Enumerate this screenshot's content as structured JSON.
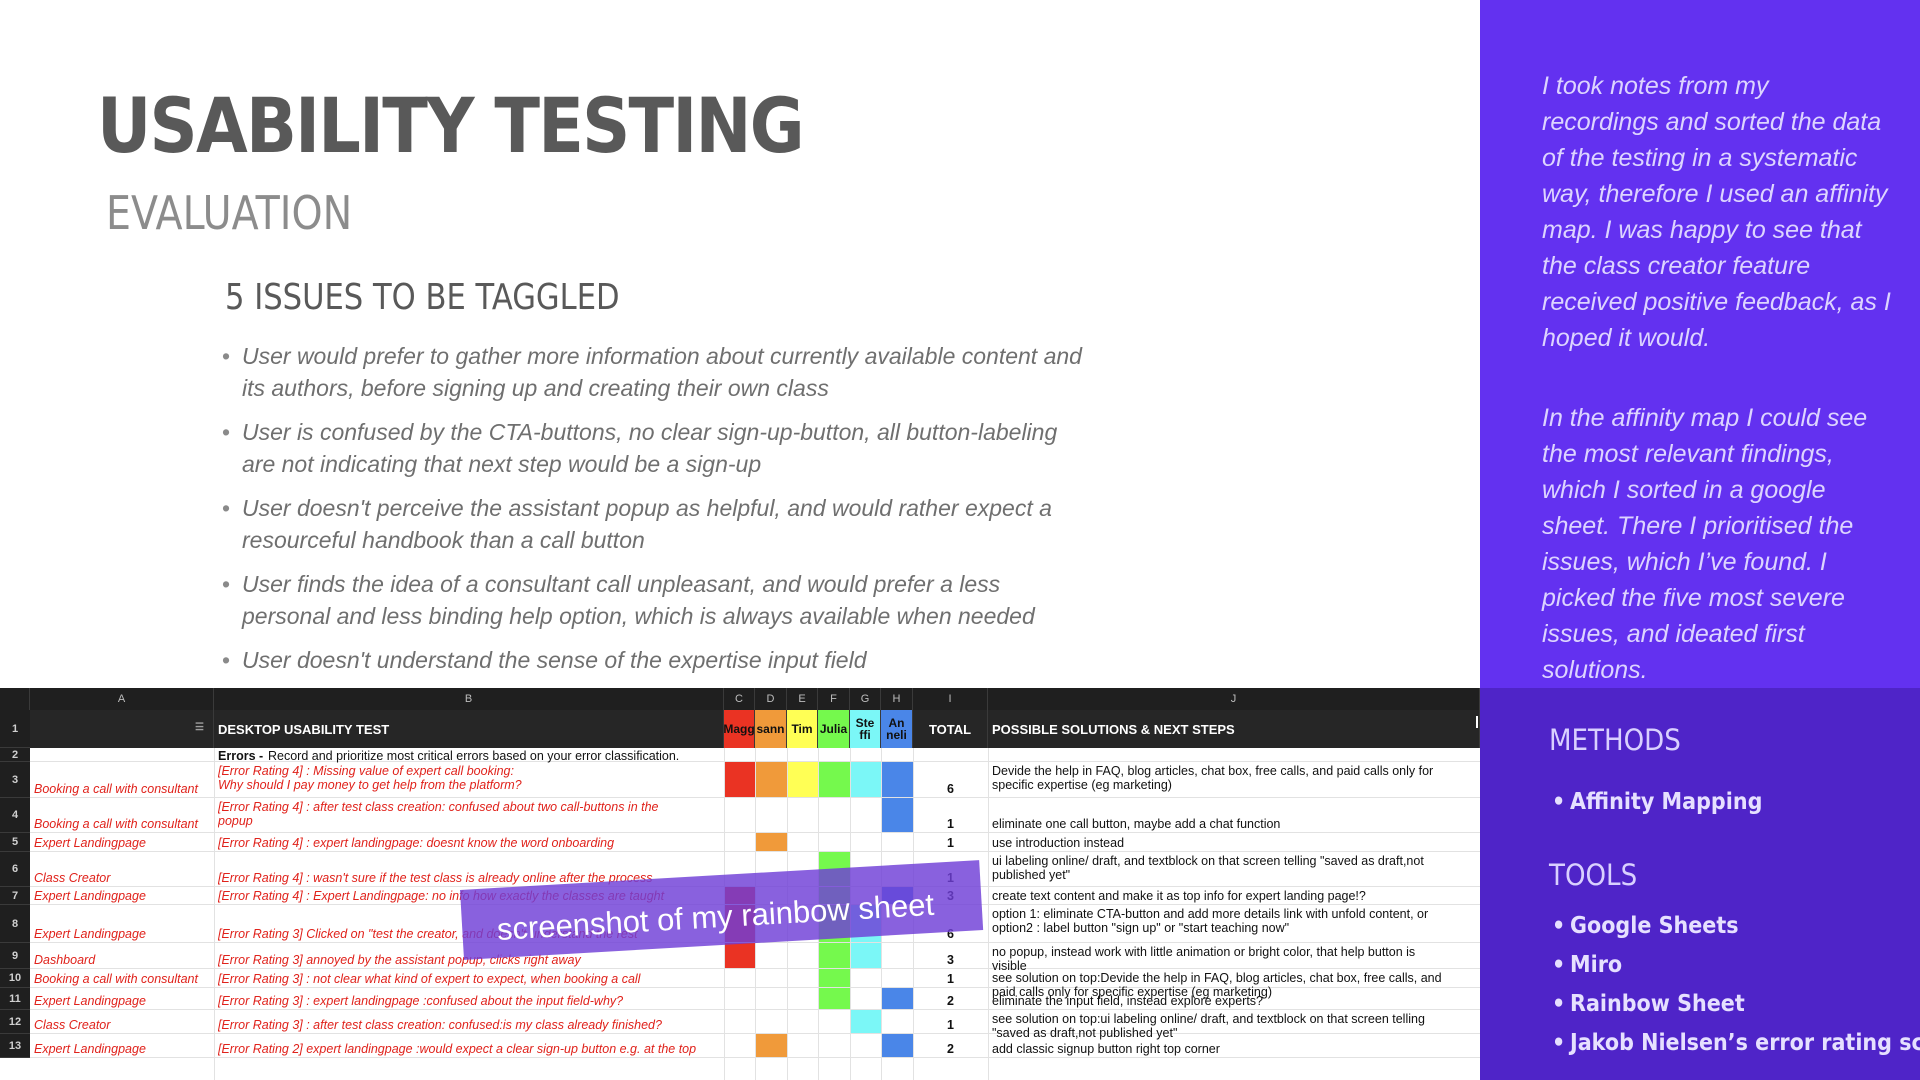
{
  "slide": {
    "title": "USABILITY TESTING",
    "subtitle": "EVALUATION",
    "issues_heading": "5 ISSUES TO BE TAGGLED",
    "issues": [
      "User would prefer to gather more information about currently available content and its authors, before signing up and creating their own class",
      "User is confused by the CTA-buttons, no clear sign-up-button, all button-labeling are not indicating that next step would be a sign-up",
      "User doesn't perceive the assistant popup as helpful, and would rather expect a resourceful handbook than a call button",
      "User finds the idea of a consultant call unpleasant, and would prefer a less personal and less binding help option, which is always available when needed",
      "User doesn't understand the sense of the expertise input field"
    ]
  },
  "panel": {
    "note_1": "I took notes from my recordings and sorted the data of the testing in a systematic way, therefore I used an affinity map. I was happy to see that the class creator feature received positive feedback, as I hoped it would.",
    "note_2": "In the affinity map I could see the most relevant findings, which I sorted in a google sheet. There I prioritised the issues, which I’ve found. I picked the five most severe issues, and ideated first solutions.",
    "methods_heading": "METHODS",
    "methods": [
      "Affinity Mapping"
    ],
    "tools_heading": "TOOLS",
    "tools": [
      "Google Sheets",
      "Miro",
      "Rainbow Sheet",
      "Jakob Nielsen’s error rating scale"
    ]
  },
  "sheet": {
    "column_letters": [
      "A",
      "B",
      "C",
      "D",
      "E",
      "F",
      "G",
      "H",
      "I",
      "J"
    ],
    "header_b": "DESKTOP USABILITY TEST",
    "participants": [
      "Magg",
      "sann",
      "Tim",
      "Julia",
      "Ste ffi",
      "An neli"
    ],
    "participant_colors": [
      "#ea3323",
      "#f09a3a",
      "#ffff55",
      "#75f94d",
      "#7bf7f7",
      "#4a86e8"
    ],
    "header_total": "TOTAL",
    "header_j": "POSSIBLE SOLUTIONS & NEXT STEPS",
    "row_numbers": [
      "1",
      "2",
      "3",
      "4",
      "5",
      "6",
      "7",
      "8",
      "9",
      "10",
      "11",
      "12",
      "13"
    ],
    "errors_label": "Errors -",
    "errors_desc": "Record and prioritize most critical errors based on your error classification.",
    "rows": [
      {
        "a": "Booking a call with consultant",
        "b1": "[Error Rating 4] : Missing value of expert call booking:",
        "b2": "Why should I pay money to get help from the platform?",
        "total": "6",
        "j1": "Devide the help in FAQ, blog articles, chat box, free calls, and paid calls only for",
        "j2": "specific expertise (eg marketing)"
      },
      {
        "a": "Booking a call with consultant",
        "b1": "[Error Rating 4] : after test class creation: confused about two call-buttons in the",
        "b2": "popup",
        "total": "1",
        "j1": "eliminate one call button, maybe add a chat function",
        "j2": ""
      },
      {
        "a": "Expert Landingpage",
        "b1": "[Error Rating 4] : expert landingpage: doesnt know the word onboarding",
        "b2": "",
        "total": "1",
        "j1": "use introduction instead",
        "j2": ""
      },
      {
        "a": "Class Creator",
        "b1": "[Error Rating 4] : wasn't sure if the test class is already online after the process",
        "b2": "",
        "total": "1",
        "j1": "ui labeling online/ draft, and textblock on that screen telling \"saved as draft,not",
        "j2": "published yet\""
      },
      {
        "a": "Expert Landingpage",
        "b1": "[Error Rating 4] : Expert Landingpage: no info how exactly the classes are taught",
        "b2": "",
        "total": "3",
        "j1": "create text content and make it as top info for expert landing page!?",
        "j2": ""
      },
      {
        "a": "Expert Landingpage",
        "b1": "[Error Rating 3] Clicked on \"test the creator, and doesn't understand the rest",
        "b2": "",
        "total": "6",
        "j1": "option 1: eliminate CTA-button and add more details link with unfold content, or",
        "j2": "option2 : label button \"sign up\" or \"start teaching now\""
      },
      {
        "a": "Dashboard",
        "b1": "[Error Rating 3] annoyed by the assistant popup, clicks right away",
        "b2": "",
        "total": "3",
        "j1": "no popup, instead work with little animation or bright color, that help button is",
        "j2": "visible"
      },
      {
        "a": "Booking a call with consultant",
        "b1": "[Error Rating 3] : not clear what kind of expert to expect, when booking a call",
        "b2": "",
        "total": "1",
        "j1": "see solution on top:Devide the help in FAQ, blog articles, chat box, free calls, and",
        "j2": "paid calls only for specific expertise (eg marketing)"
      },
      {
        "a": "Expert Landingpage",
        "b1": "[Error Rating 3] : expert landingpage :confused about the input field-why?",
        "b2": "",
        "total": "2",
        "j1": "eliminate the input field, instead explore experts?",
        "j2": ""
      },
      {
        "a": "Class Creator",
        "b1": "[Error Rating 3] : after test class creation: confused:is my class already finished?",
        "b2": "",
        "total": "1",
        "j1": "see solution on top:ui labeling online/ draft, and textblock on that screen telling",
        "j2": "\"saved as draft,not published yet\""
      },
      {
        "a": "Expert Landingpage",
        "b1": "[Error Rating 2] expert landingpage :would expect a clear sign-up button e.g. at the top",
        "b2": "",
        "total": "2",
        "j1": "add classic signup button right top corner",
        "j2": ""
      }
    ],
    "overlay_caption": "screenshot of my rainbow sheet"
  }
}
